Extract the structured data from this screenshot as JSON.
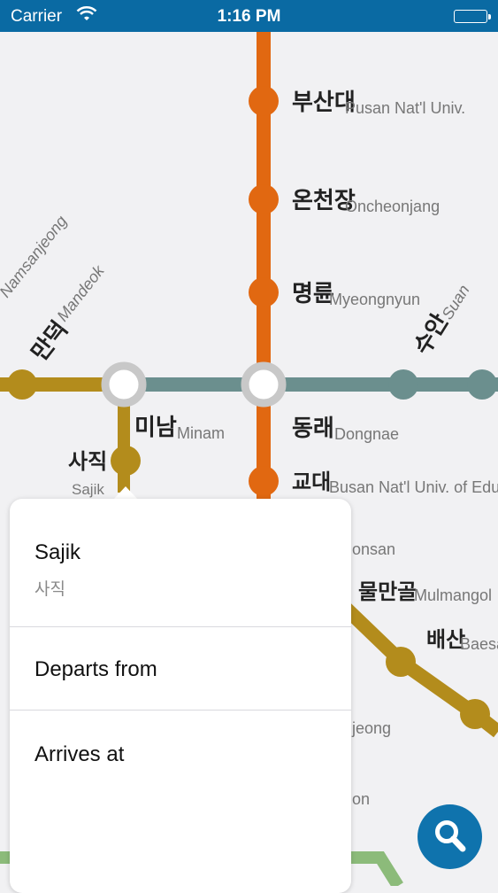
{
  "status_bar": {
    "carrier": "Carrier",
    "time": "1:16 PM"
  },
  "map": {
    "colors": {
      "orange": "#e16811",
      "gold": "#b38c1c",
      "teal": "#6b8f8e",
      "green": "#8cbb7a",
      "transfer": "#c8c8c8"
    },
    "stations": {
      "pusan_univ": {
        "ko": "부산대",
        "en": "Pusan Nat'l Univ."
      },
      "oncheonjang": {
        "ko": "온천장",
        "en": "Oncheonjang"
      },
      "myeongnyun": {
        "ko": "명륜",
        "en": "Myeongnyun"
      },
      "suan": {
        "ko": "수안",
        "en": "Suan"
      },
      "namsanjeong": {
        "en": "Namsanjeong"
      },
      "mandeok": {
        "ko": "만덕",
        "en": "Mandeok"
      },
      "minam": {
        "ko": "미남",
        "en": "Minam"
      },
      "sajik": {
        "ko": "사직",
        "en": "Sajik"
      },
      "dongnae": {
        "ko": "동래",
        "en": "Dongnae"
      },
      "gyodae": {
        "ko": "교대",
        "en": "Busan Nat'l Univ. of Edu."
      },
      "yeonsan_partial": {
        "en": "onsan"
      },
      "mulmangol": {
        "ko": "물만골",
        "en": "Mulmangol"
      },
      "baesan": {
        "ko": "배산",
        "en": "Baesan"
      },
      "partial_jeong": {
        "en": "jeong"
      },
      "partial_on": {
        "en": "on"
      }
    }
  },
  "popover": {
    "station_name_en": "Sajik",
    "station_name_ko": "사직",
    "departs_label": "Departs from",
    "arrives_label": "Arrives at"
  },
  "search_button": {
    "icon": "magnifier-icon"
  }
}
